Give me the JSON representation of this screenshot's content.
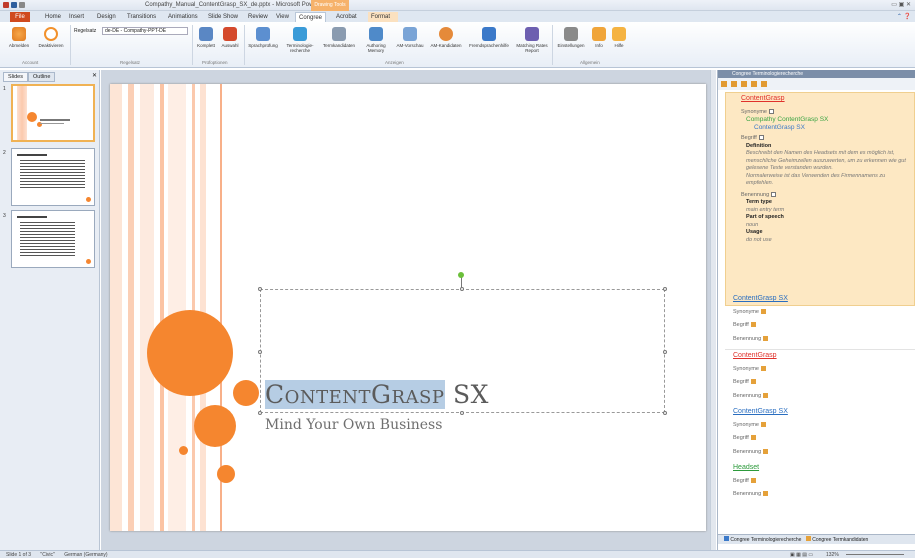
{
  "window": {
    "title": "Compathy_Manual_ContentGrasp_SX_de.pptx - Microsoft PowerPoint",
    "contextual_tab": "Drawing Tools"
  },
  "tabs": [
    "File",
    "Home",
    "Insert",
    "Design",
    "Transitions",
    "Animations",
    "Slide Show",
    "Review",
    "View",
    "Congree",
    "Acrobat",
    "Format"
  ],
  "ribbon": {
    "buttons": {
      "abmelden": "Abmelden",
      "deaktivieren": "Deaktivieren",
      "regelsatz_label": "Regelsatz",
      "regelsatz_value": "de-DE - Compathy-PPT-DE",
      "komplett": "Komplett",
      "auswahl": "Auswahl",
      "sprachpruefung": "Sprachprüfung",
      "terminologie": "Terminologie-recherche",
      "termkandidaten": "Termkandidaten",
      "authoring": "Authoring Memory",
      "am_vorschau": "AM-Vorschau",
      "am_kandidaten": "AM-Kandidaten",
      "fremdsprachen": "Fremdsprachenhilfe",
      "matching": "Matching Rates Report",
      "einstellungen": "Einstellungen",
      "info": "Info",
      "hilfe": "Hilfe"
    },
    "groups": [
      "Account",
      "Regelsatz",
      "Prüfoptionen",
      "Anzeigen",
      "Allgemein"
    ]
  },
  "left_pane": {
    "tabs": [
      "Slides",
      "Outline"
    ],
    "slide_numbers": [
      "1",
      "2",
      "3"
    ]
  },
  "slide": {
    "title_selected": "ContentGrasp",
    "title_rest": " SX",
    "subtitle": "Mind Your Own Business"
  },
  "right_pane": {
    "header": "Congree Terminologierecherche",
    "entry1": {
      "title": "ContentGrasp",
      "synonyme_label": "Synonyme",
      "syn1": "Compathy ContentGrasp SX",
      "syn2": "ContentGrasp SX",
      "begriff_label": "Begriff",
      "definition_label": "Definition",
      "definition_text": "Beschreibt den Namen des Headsets mit dem es möglich ist, menschliche Geheimzellen auszuwerten, um zu erkennen wie gut gelesene Texte verstanden wurden.",
      "definition_note": "Normalerweise ist das Verwenden des Firmennamens zu empfehlen.",
      "benennung_label": "Benennung",
      "term_type_label": "Term type",
      "term_type_value": "main entry term",
      "pos_label": "Part of speech",
      "pos_value": "noun",
      "usage_label": "Usage",
      "usage_value": "do not use"
    },
    "entries": [
      {
        "title": "ContentGrasp SX",
        "color": "blue",
        "rows": [
          "Synonyme",
          "Begriff",
          "Benennung"
        ]
      },
      {
        "title": "ContentGrasp",
        "color": "red",
        "rows": [
          "Synonyme",
          "Begriff",
          "Benennung"
        ]
      },
      {
        "title": "ContentGrasp SX",
        "color": "blue",
        "rows": [
          "Synonyme",
          "Begriff",
          "Benennung"
        ]
      },
      {
        "title": "Headset",
        "color": "green",
        "rows": [
          "Begriff",
          "Benennung"
        ]
      }
    ],
    "bottom_tabs": [
      "Congree Terminologierecherche",
      "Congree Termkandidaten"
    ]
  },
  "status": {
    "slide": "Slide 1 of 3",
    "theme": "\"Civic\"",
    "language": "German (Germany)",
    "zoom": "132%"
  }
}
